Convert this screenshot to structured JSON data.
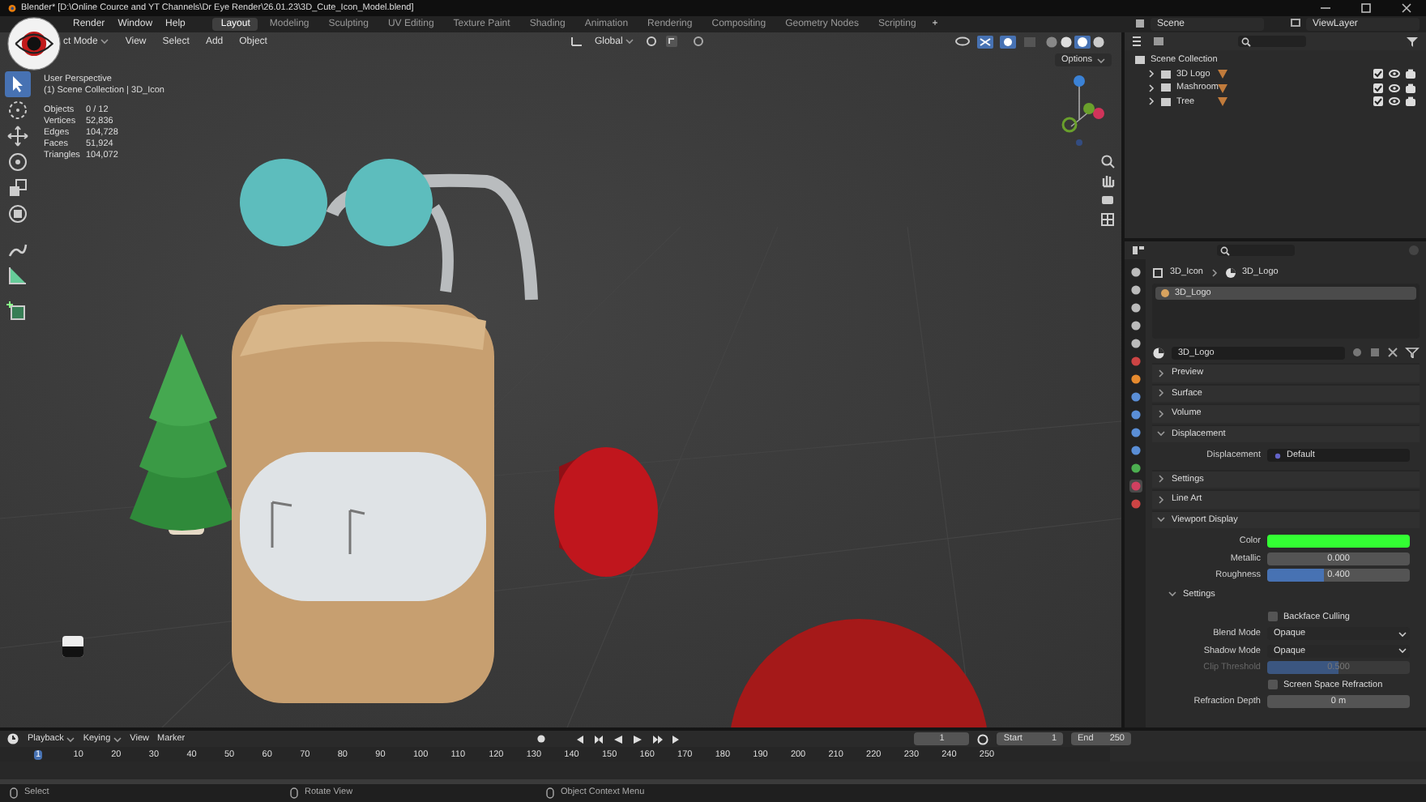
{
  "window": {
    "title": "Blender* [D:\\Online Cource and YT Channels\\Dr Eye Render\\26.01.23\\3D_Cute_Icon_Model.blend]"
  },
  "menu": [
    "Render",
    "Window",
    "Help"
  ],
  "workspaces": [
    {
      "label": "Layout",
      "selected": true
    },
    {
      "label": "Modeling",
      "selected": false
    },
    {
      "label": "Sculpting",
      "selected": false
    },
    {
      "label": "UV Editing",
      "selected": false
    },
    {
      "label": "Texture Paint",
      "selected": false
    },
    {
      "label": "Shading",
      "selected": false
    },
    {
      "label": "Animation",
      "selected": false
    },
    {
      "label": "Rendering",
      "selected": false
    },
    {
      "label": "Compositing",
      "selected": false
    },
    {
      "label": "Geometry Nodes",
      "selected": false
    },
    {
      "label": "Scripting",
      "selected": false
    }
  ],
  "add_workspace": "+",
  "scene": "Scene",
  "view_layer": "ViewLayer",
  "viewport": {
    "mode": "ct Mode",
    "menus": [
      "View",
      "Select",
      "Add",
      "Object"
    ],
    "orientation": "Global",
    "options": "Options",
    "info_title": "User Perspective",
    "info_context": "(1) Scene Collection | 3D_Icon",
    "stats": [
      {
        "label": "Objects",
        "value": "0 / 12"
      },
      {
        "label": "Vertices",
        "value": "52,836"
      },
      {
        "label": "Edges",
        "value": "104,728"
      },
      {
        "label": "Faces",
        "value": "51,924"
      },
      {
        "label": "Triangles",
        "value": "104,072"
      }
    ],
    "tools": [
      {
        "kind": "select",
        "selected": true
      },
      {
        "kind": "cursor",
        "selected": false
      },
      {
        "kind": "move",
        "selected": false
      },
      {
        "kind": "rotate",
        "selected": false
      },
      {
        "kind": "scale",
        "selected": false
      },
      {
        "kind": "transform",
        "selected": false
      },
      {
        "kind": "annotate",
        "selected": false
      },
      {
        "kind": "measure",
        "selected": false
      },
      {
        "kind": "add",
        "selected": false
      }
    ]
  },
  "outliner": {
    "root": "Scene Collection",
    "items": [
      {
        "name": "3D Logo",
        "checked": true
      },
      {
        "name": "Mashroom",
        "checked": true
      },
      {
        "name": "Tree",
        "checked": true
      }
    ]
  },
  "properties": {
    "breadcrumb": [
      "3D_Icon",
      "3D_Logo"
    ],
    "slots": [
      {
        "name": "3D_Logo",
        "selected": true
      }
    ],
    "material": "3D_Logo",
    "panels": [
      {
        "title": "Preview",
        "expanded": false
      },
      {
        "title": "Surface",
        "expanded": false
      },
      {
        "title": "Volume",
        "expanded": false
      },
      {
        "title": "Displacement",
        "expanded": true,
        "rows": [
          {
            "kind": "link",
            "label": "Displacement",
            "value": "Default"
          }
        ]
      },
      {
        "title": "Settings",
        "expanded": false
      },
      {
        "title": "Line Art",
        "expanded": false
      },
      {
        "title": "Viewport Display",
        "expanded": true,
        "rows": [
          {
            "kind": "color",
            "label": "Color",
            "color": "#33ff33"
          },
          {
            "kind": "slider",
            "label": "Metallic",
            "value": "0.000",
            "disabled": false
          },
          {
            "kind": "slider",
            "label": "Roughness",
            "value": "0.400",
            "level": 0.4,
            "disabled": false
          },
          {
            "kind": "subpanel",
            "title": "Settings",
            "expanded": true,
            "rows": [
              {
                "kind": "checkbox",
                "label": "Backface Culling",
                "checked": false
              },
              {
                "kind": "dropdown",
                "label": "Blend Mode",
                "value": "Opaque"
              },
              {
                "kind": "dropdown",
                "label": "Shadow Mode",
                "value": "Opaque"
              },
              {
                "kind": "slider",
                "label": "Clip Threshold",
                "value": "0.500",
                "level": 0.5,
                "disabled": true
              },
              {
                "kind": "checkbox",
                "label": "Screen Space Refraction",
                "checked": false
              },
              {
                "kind": "number",
                "label": "Refraction Depth",
                "value": "0 m"
              }
            ]
          }
        ]
      }
    ]
  },
  "timeline": {
    "menus": [
      "Playback",
      "Keying",
      "View",
      "Marker"
    ],
    "current_frame": "1",
    "start": {
      "label": "Start",
      "value": "1"
    },
    "end": {
      "label": "End",
      "value": "250"
    },
    "ticks": [
      {
        "label": "1",
        "selected": true
      },
      {
        "label": "10",
        "selected": false
      },
      {
        "label": "20",
        "selected": false
      },
      {
        "label": "30",
        "selected": false
      },
      {
        "label": "40",
        "selected": false
      },
      {
        "label": "50",
        "selected": false
      },
      {
        "label": "60",
        "selected": false
      },
      {
        "label": "70",
        "selected": false
      },
      {
        "label": "80",
        "selected": false
      },
      {
        "label": "90",
        "selected": false
      },
      {
        "label": "100",
        "selected": false
      },
      {
        "label": "110",
        "selected": false
      },
      {
        "label": "120",
        "selected": false
      },
      {
        "label": "130",
        "selected": false
      },
      {
        "label": "140",
        "selected": false
      },
      {
        "label": "150",
        "selected": false
      },
      {
        "label": "160",
        "selected": false
      },
      {
        "label": "170",
        "selected": false
      },
      {
        "label": "180",
        "selected": false
      },
      {
        "label": "190",
        "selected": false
      },
      {
        "label": "200",
        "selected": false
      },
      {
        "label": "210",
        "selected": false
      },
      {
        "label": "220",
        "selected": false
      },
      {
        "label": "230",
        "selected": false
      },
      {
        "label": "240",
        "selected": false
      },
      {
        "label": "250",
        "selected": false
      }
    ]
  },
  "status_bar": [
    "Select",
    "Rotate View",
    "Object Context Menu"
  ]
}
